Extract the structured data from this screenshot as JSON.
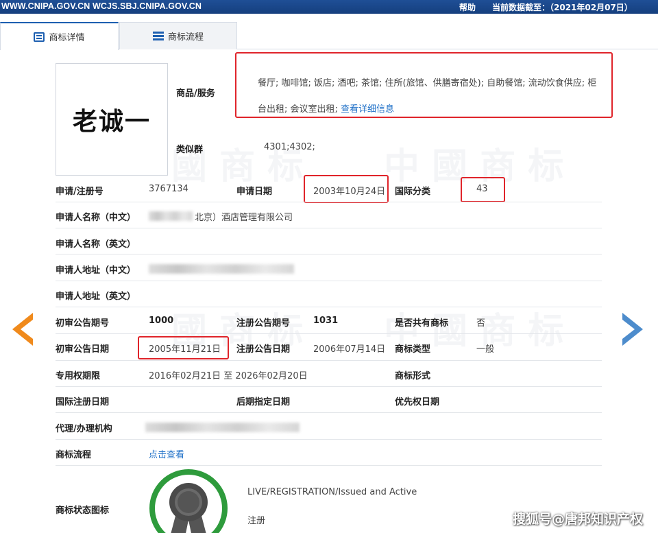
{
  "topbar": {
    "site": "WWW.CNIPA.GOV.CN WCJS.SBJ.CNIPA.GOV.CN",
    "help": "帮助",
    "data_as_of": "当前数据截至：（2021年02月07日）"
  },
  "tabs": [
    {
      "label": "商标详情",
      "icon": "detail-icon",
      "active": true
    },
    {
      "label": "商标流程",
      "icon": "list-icon",
      "active": false
    }
  ],
  "trademark": {
    "image_text": "老诚一",
    "goods_label": "商品/服务",
    "goods_line1": "餐厅; 咖啡馆; 饭店; 酒吧; 茶馆; 住所(旅馆、供膳寄宿处); 自助餐馆; 流动饮食供应; 柜",
    "goods_line2": "台出租; 会议室出租;",
    "goods_link": "查看详细信息",
    "similar_label": "类似群",
    "similar_value": "4301;4302;"
  },
  "fields": {
    "reg_no_label": "申请/注册号",
    "reg_no": "3767134",
    "app_date_label": "申请日期",
    "app_date": "2003年10月24日",
    "intl_class_label": "国际分类",
    "intl_class": "43",
    "applicant_cn_label": "申请人名称（中文）",
    "applicant_cn": "北京）酒店管理有限公司",
    "applicant_en_label": "申请人名称（英文）",
    "address_cn_label": "申请人地址（中文）",
    "address_en_label": "申请人地址（英文）",
    "prelim_no_label": "初审公告期号",
    "prelim_no": "1000",
    "reg_notice_no_label": "注册公告期号",
    "reg_notice_no": "1031",
    "shared_label": "是否共有商标",
    "shared": "否",
    "prelim_date_label": "初审公告日期",
    "prelim_date": "2005年11月21日",
    "reg_notice_date_label": "注册公告日期",
    "reg_notice_date": "2006年07月14日",
    "tm_type_label": "商标类型",
    "tm_type": "一般",
    "exclusive_label": "专用权期限",
    "exclusive": "2016年02月21日 至 2026年02月20日",
    "tm_form_label": "商标形式",
    "intl_reg_date_label": "国际注册日期",
    "later_date_label": "后期指定日期",
    "priority_date_label": "优先权日期",
    "agent_label": "代理/办理机构",
    "process_label": "商标流程",
    "process_link": "点击查看",
    "status_icon_label": "商标状态图标",
    "status_en": "LIVE/REGISTRATION/Issued and Active",
    "status_cn": "注册"
  },
  "footer_mark": "搜狐号@唐邦知识产权",
  "colors": {
    "topbar": "#1f4f96",
    "highlight": "#e0242a",
    "link": "#1d6fc7",
    "prev_arrow": "#f08a1c",
    "next_arrow": "#4d8ccc",
    "status_ring": "#2e9b3c"
  }
}
